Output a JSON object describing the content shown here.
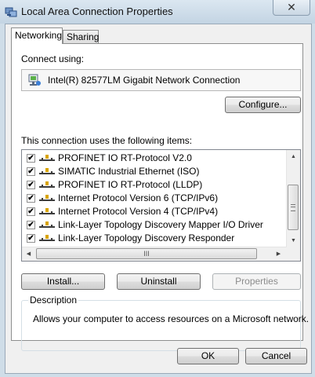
{
  "window": {
    "title": "Local Area Connection Properties",
    "close_glyph": "✕"
  },
  "tabs": [
    {
      "label": "Networking",
      "active": true
    },
    {
      "label": "Sharing",
      "active": false
    }
  ],
  "connect_using": {
    "label": "Connect using:",
    "adapter_name": "Intel(R) 82577LM Gigabit Network Connection",
    "adapter_icon": "network-adapter-icon"
  },
  "buttons": {
    "configure": "Configure...",
    "install": "Install...",
    "uninstall": "Uninstall",
    "properties": "Properties",
    "ok": "OK",
    "cancel": "Cancel"
  },
  "items_label": "This connection uses the following items:",
  "items": [
    {
      "label": "PROFINET IO RT-Protocol V2.0",
      "checked": true
    },
    {
      "label": "SIMATIC Industrial Ethernet (ISO)",
      "checked": true
    },
    {
      "label": "PROFINET IO RT-Protocol (LLDP)",
      "checked": true
    },
    {
      "label": "Internet Protocol Version 6 (TCP/IPv6)",
      "checked": true
    },
    {
      "label": "Internet Protocol Version 4 (TCP/IPv4)",
      "checked": true
    },
    {
      "label": "Link-Layer Topology Discovery Mapper I/O Driver",
      "checked": true
    },
    {
      "label": "Link-Layer Topology Discovery Responder",
      "checked": true
    }
  ],
  "scroll_glyphs": {
    "up": "▲",
    "down": "▼",
    "left": "◀",
    "right": "▶",
    "grip": "III"
  },
  "description": {
    "heading": "Description",
    "text": "Allows your computer to access resources on a Microsoft network."
  },
  "colors": {
    "check": "#1a1a1a",
    "icon_yellow": "#d9a400",
    "icon_dark": "#3c3c3c"
  }
}
